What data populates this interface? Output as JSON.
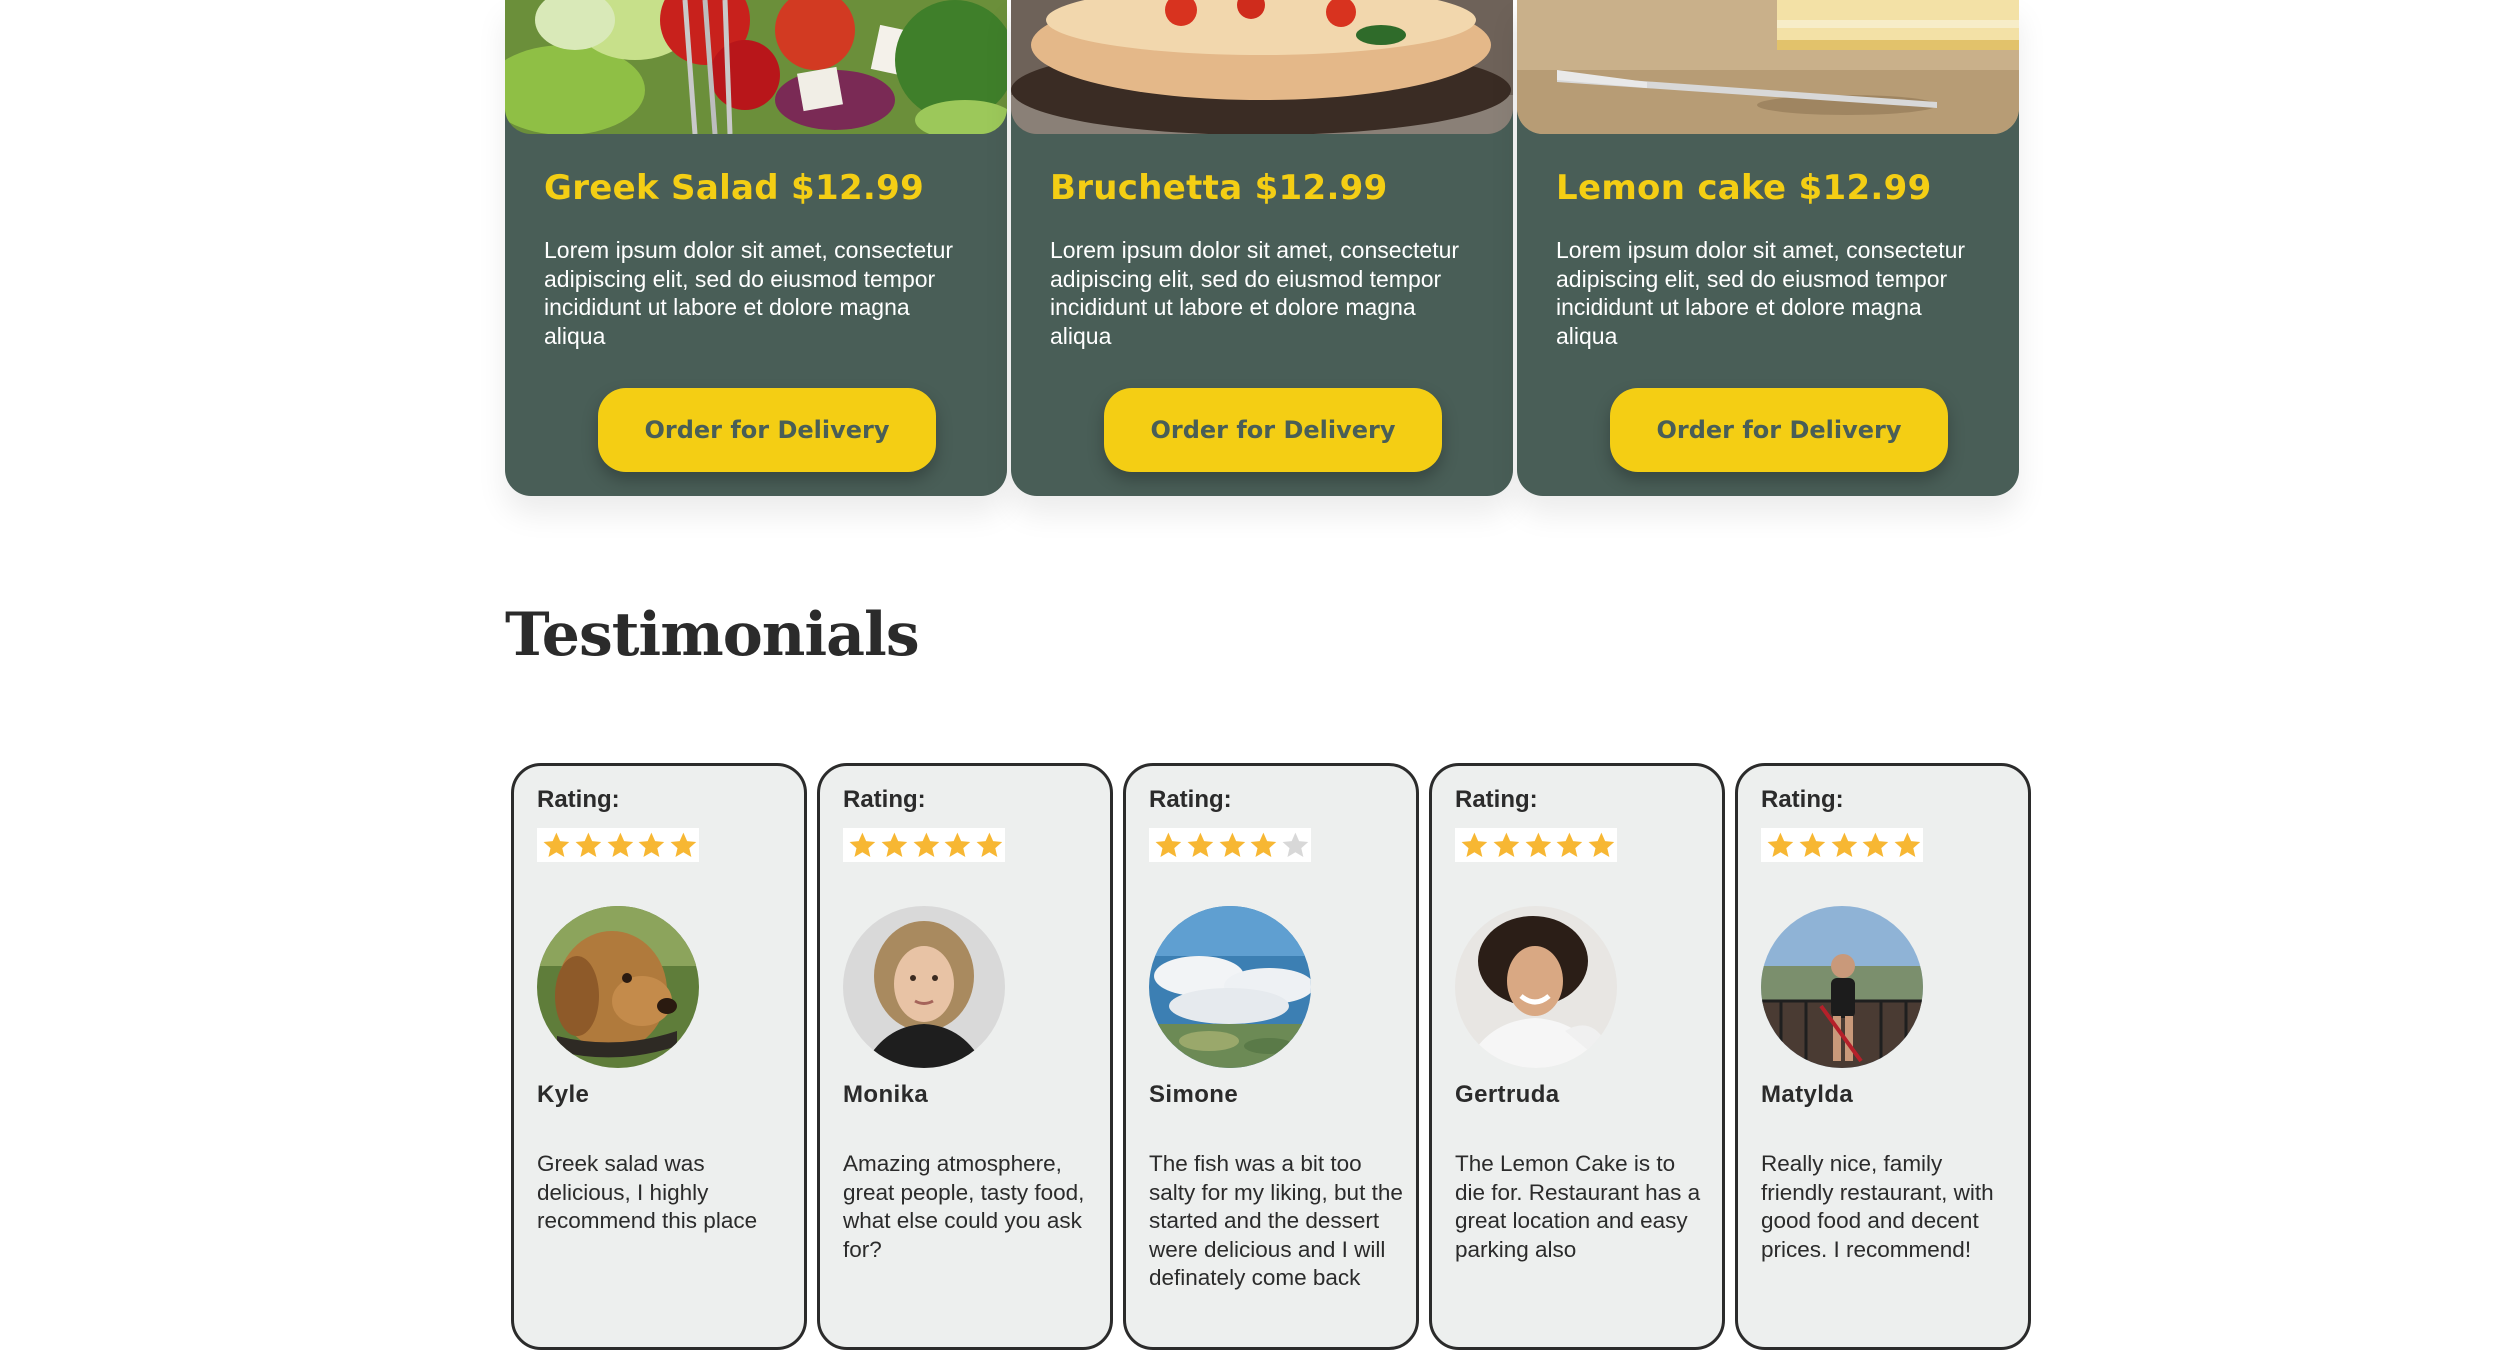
{
  "specials": [
    {
      "title": "Greek Salad $12.99",
      "description": "Lorem ipsum dolor sit amet, consectetur adipiscing elit, sed do eiusmod tempor incididunt ut labore et dolore magna aliqua",
      "button_label": "Order for Delivery"
    },
    {
      "title": "Bruchetta $12.99",
      "description": "Lorem ipsum dolor sit amet, consectetur adipiscing elit, sed do eiusmod tempor incididunt ut labore et dolore magna aliqua",
      "button_label": "Order for Delivery"
    },
    {
      "title": "Lemon cake $12.99",
      "description": "Lorem ipsum dolor sit amet, consectetur adipiscing elit, sed do eiusmod tempor incididunt ut labore et dolore magna aliqua",
      "button_label": "Order for Delivery"
    }
  ],
  "testimonials": {
    "title": "Testimonials",
    "items": [
      {
        "rating_label": "Rating:",
        "rating": 5,
        "name": "Kyle",
        "text": "Greek salad was delicious, I highly recommend this place"
      },
      {
        "rating_label": "Rating:",
        "rating": 5,
        "name": "Monika",
        "text": "Amazing atmosphere, great people, tasty food, what else could you ask for?"
      },
      {
        "rating_label": "Rating:",
        "rating": 4,
        "name": "Simone",
        "text": "The fish was a bit too salty for my liking, but the started and the dessert were delicious and I will definately come back"
      },
      {
        "rating_label": "Rating:",
        "rating": 5,
        "name": "Gertruda",
        "text": "The Lemon Cake is to die for. Restaurant has a great location and easy parking also"
      },
      {
        "rating_label": "Rating:",
        "rating": 5,
        "name": "Matylda",
        "text": "Really nice, family friendly restaurant, with good food and decent prices. I recommend!"
      }
    ]
  },
  "colors": {
    "card_green": "#495e57",
    "accent_yellow": "#f4ce14",
    "star_filled": "#f7b733",
    "star_empty": "#d8d8d8",
    "testimonial_bg": "#edefee",
    "text_dark": "#2b2b2b"
  },
  "icons": {
    "star": "star-icon"
  }
}
